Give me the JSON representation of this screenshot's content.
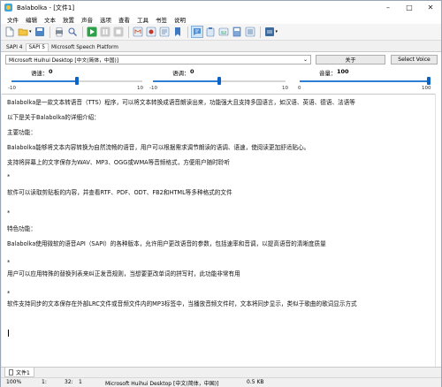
{
  "window": {
    "title": "Balabolka - [文件1]"
  },
  "menu": [
    "文件",
    "编辑",
    "文本",
    "放置",
    "声音",
    "选项",
    "查看",
    "工具",
    "书签",
    "说明"
  ],
  "toolbar": {
    "icons": [
      "new-file-icon",
      "open-folder-icon",
      "save-icon",
      "print-icon",
      "find-icon",
      "play-icon",
      "pause-icon",
      "stop-icon",
      "convert-audio-icon",
      "record-icon",
      "text-split-icon",
      "bookmark-icon",
      "speech-file-icon",
      "clipboard-read-icon",
      "settings-icon",
      "help-icon"
    ]
  },
  "engine_tabs": [
    "SAPI 4",
    "SAPI 5",
    "Microsoft Speech Platform"
  ],
  "engine_active": "SAPI 5",
  "voice": {
    "selected": "Microsoft Huihui Desktop [中文(简体，中国)]",
    "about_label": "关于",
    "select_voice_label": "Select Voice"
  },
  "sliders": {
    "rate": {
      "label": "语速：",
      "value": "0",
      "min_label": "-10",
      "max_label": "10",
      "level": 0.5
    },
    "pitch": {
      "label": "语调：",
      "value": "0",
      "min_label": "-10",
      "max_label": "10",
      "level": 0.5
    },
    "volume": {
      "label": "音量：",
      "value": "100",
      "min_label": "0",
      "max_label": "100",
      "level": 1.0
    }
  },
  "document": {
    "lines": [
      "Balabolka是一款文本转语音（TTS）程序，可以将文本转换成语音朗读出来，功能强大且支持多国语言，如汉语、英语、德语、法语等",
      "以下是关于Balabolka的详细介绍：",
      "主要功能：",
      "Balabolka能够将文本内容转换为自然流畅的语音，用户可以根据需求调节朗读的语调、语速，使阅读更加舒适贴心。",
      "支持将屏幕上的文字保存为WAV、MP3、OGG或WMA等音频格式，方便用户随时聆听",
      "软件可以读取剪贴板的内容，并查看RTF、PDF、ODT、FB2和HTML等多种格式的文件",
      "特色功能：",
      "Balabolka使用微软的语音API（SAPI）的各种版本，允许用户更改语音的参数，包括速率和音调，以提高语音的清晰度质量",
      "用户可以应用特殊的替换列表来纠正发音规则，当想要更改单词的拼写时，此功能非常有用",
      "软件支持同步的文本保存在外部LRC文件或音频文件内的MP3标签中，当播放音频文件时，文本将同步显示，类似于歌曲的歌词显示方式"
    ],
    "bullets": [
      "*",
      "*",
      "*",
      "*"
    ]
  },
  "doc_tab": {
    "label": "文件1"
  },
  "status": {
    "zoom": "100%",
    "line": "1:",
    "col": "32:",
    "pos": "1",
    "voice": "Microsoft Huihui Desktop [中文(简体，中国)]",
    "size": "0.5 KB"
  }
}
